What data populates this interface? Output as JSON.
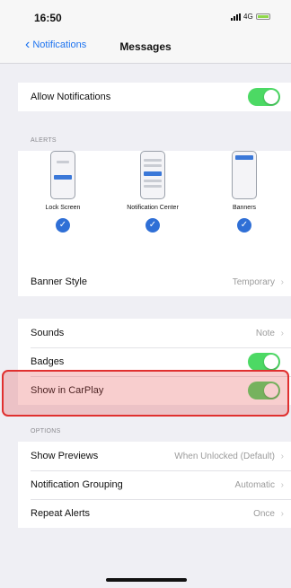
{
  "status_bar": {
    "time": "16:50",
    "network": "4G"
  },
  "nav": {
    "back_label": "Notifications",
    "title": "Messages"
  },
  "allow_notifications": {
    "label": "Allow Notifications",
    "enabled": true
  },
  "alerts": {
    "header": "ALERTS",
    "items": [
      {
        "label": "Lock Screen",
        "selected": true
      },
      {
        "label": "Notification Center",
        "selected": true
      },
      {
        "label": "Banners",
        "selected": true
      }
    ]
  },
  "banner_style": {
    "label": "Banner Style",
    "value": "Temporary"
  },
  "sounds": {
    "label": "Sounds",
    "value": "Note"
  },
  "badges": {
    "label": "Badges",
    "enabled": true
  },
  "show_in_carplay": {
    "label": "Show in CarPlay",
    "enabled": true
  },
  "options": {
    "header": "OPTIONS",
    "show_previews": {
      "label": "Show Previews",
      "value": "When Unlocked (Default)"
    },
    "notification_grouping": {
      "label": "Notification Grouping",
      "value": "Automatic"
    },
    "repeat_alerts": {
      "label": "Repeat Alerts",
      "value": "Once"
    }
  },
  "colors": {
    "accent": "#1e74f0",
    "toggle_on": "#4cd964",
    "highlight_border": "#e0302f"
  }
}
